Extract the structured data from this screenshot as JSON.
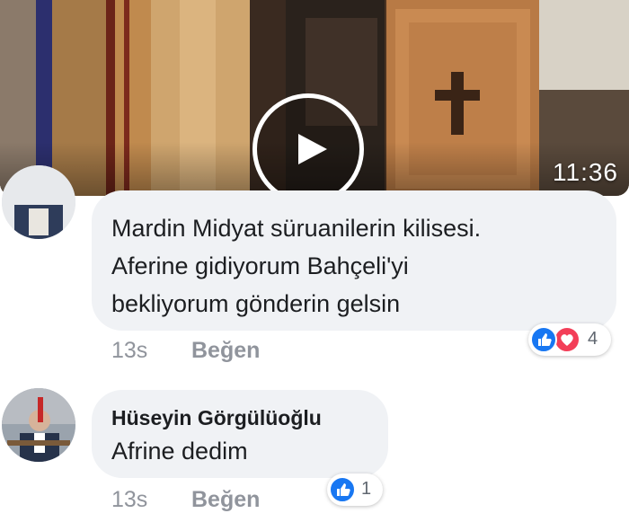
{
  "video": {
    "duration": "11:36",
    "play_icon": "play-icon"
  },
  "comments": [
    {
      "author": "",
      "lines": [
        "Mardin Midyat  süruanilerin kilisesi.",
        "Aferine gidiyorum  Bahçeli'yi",
        "bekliyorum  gönderin gelsin"
      ],
      "time": "13s",
      "like_label": "Beğen",
      "reactions": {
        "icons": [
          "like-icon",
          "love-icon"
        ],
        "count": "4"
      }
    },
    {
      "author": "Hüseyin Görgülüoğlu",
      "lines": [
        "Afrine dedim"
      ],
      "time": "13s",
      "like_label": "Beğen",
      "reactions": {
        "icons": [
          "like-icon"
        ],
        "count": "1"
      }
    }
  ],
  "colors": {
    "like_blue": "#1877f2",
    "love_red": "#f33e58",
    "bubble_bg": "#f0f2f5",
    "meta_gray": "#90949c"
  }
}
